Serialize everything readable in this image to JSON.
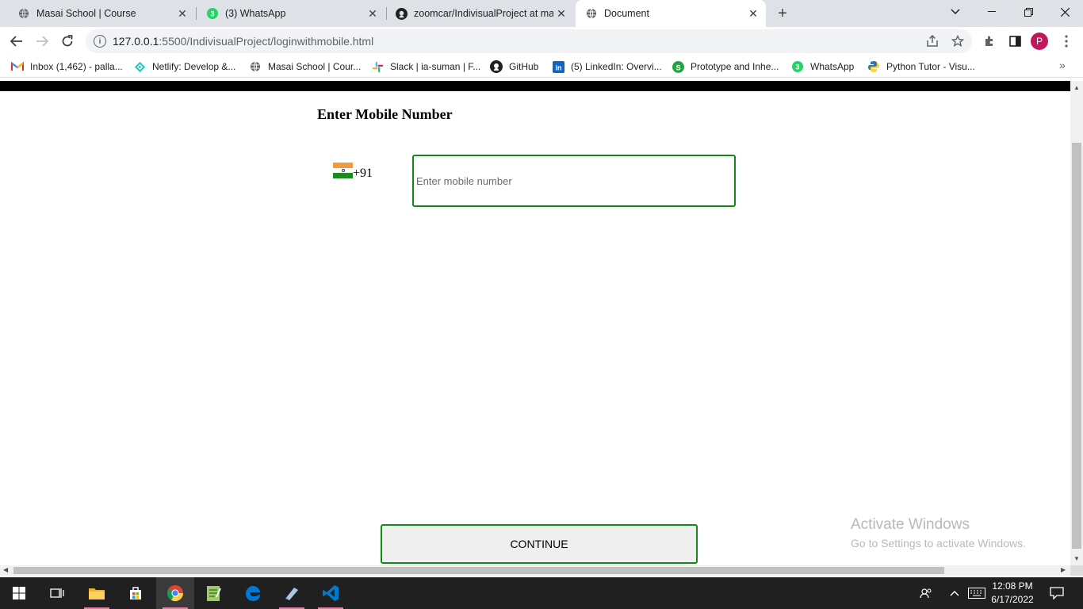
{
  "tabs": [
    {
      "title": "Masai School | Course",
      "icon": "globe-icon"
    },
    {
      "title": "(3) WhatsApp",
      "icon": "whatsapp-icon",
      "badge": "3"
    },
    {
      "title": "zoomcar/IndivisualProject at mas",
      "icon": "github-icon"
    },
    {
      "title": "Document",
      "icon": "globe-icon"
    }
  ],
  "toolbar": {
    "url_host": "127.0.0.1",
    "url_rest": ":5500/IndivisualProject/loginwithmobile.html",
    "profile_initial": "P"
  },
  "bookmarks": [
    {
      "label": "Inbox (1,462) - palla...",
      "icon": "gmail-icon",
      "icon_glyph": "M",
      "icon_color": "#d93025"
    },
    {
      "label": "Netlify: Develop &...",
      "icon": "netlify-icon",
      "icon_glyph": "◆",
      "icon_color": "#25c7b7"
    },
    {
      "label": "Masai School | Cour...",
      "icon": "globe-icon",
      "icon_glyph": "●",
      "icon_color": "#5f6368"
    },
    {
      "label": "Slack | ia-suman | F...",
      "icon": "slack-icon",
      "icon_glyph": "#",
      "icon_color": "#e01e5a"
    },
    {
      "label": "GitHub",
      "icon": "github-icon",
      "icon_glyph": "●",
      "icon_color": "#202124"
    },
    {
      "label": "(5) LinkedIn: Overvi...",
      "icon": "linkedin-icon",
      "icon_glyph": "in",
      "icon_color": "#0a66c2"
    },
    {
      "label": "Prototype and Inhe...",
      "icon": "globe-icon",
      "icon_glyph": "S",
      "icon_color": "#25a244"
    },
    {
      "label": "WhatsApp",
      "icon": "whatsapp-icon",
      "icon_glyph": "3",
      "icon_color": "#25d366"
    },
    {
      "label": "Python Tutor - Visu...",
      "icon": "python-icon",
      "icon_glyph": "●",
      "icon_color": "#3776ab"
    }
  ],
  "page": {
    "heading": "Enter Mobile Number",
    "country_code": "+91",
    "mobile_placeholder": "Enter mobile number",
    "mobile_value": "",
    "continue_label": "CONTINUE",
    "accent_color": "#118a11"
  },
  "watermark": {
    "line1": "Activate Windows",
    "line2": "Go to Settings to activate Windows."
  },
  "taskbar": {
    "time": "12:08 PM",
    "date": "6/17/2022"
  }
}
